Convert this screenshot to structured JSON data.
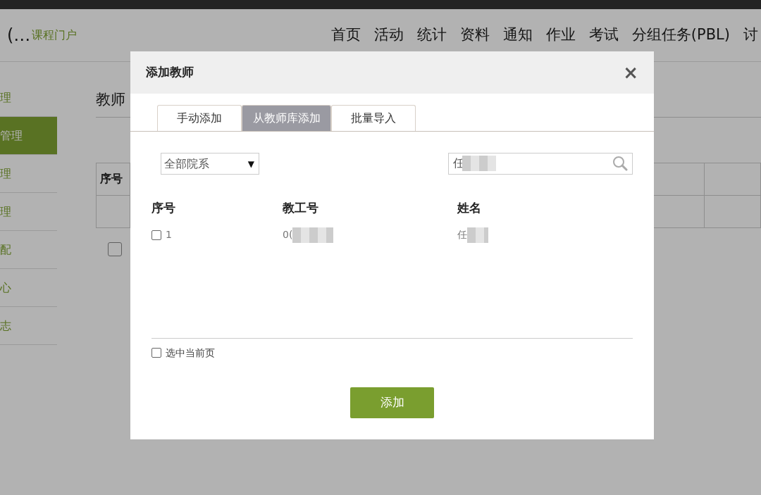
{
  "page": {
    "brand_prefix": "(…",
    "brand": "课程门户",
    "nav": [
      "首页",
      "活动",
      "统计",
      "资料",
      "通知",
      "作业",
      "考试",
      "分组任务(PBL)",
      "讨"
    ],
    "sidebar": [
      {
        "label": "理",
        "selected": false
      },
      {
        "label": "管理",
        "selected": true
      },
      {
        "label": "理",
        "selected": false
      },
      {
        "label": "理",
        "selected": false
      },
      {
        "label": "配",
        "selected": false
      },
      {
        "label": "心",
        "selected": false
      },
      {
        "label": "志",
        "selected": false
      }
    ],
    "heading": "教师",
    "table_header": "序号",
    "row_checked": false
  },
  "dialog": {
    "title": "添加教师",
    "close": "×",
    "tabs": [
      {
        "label": "手动添加",
        "selected": false
      },
      {
        "label": "从教师库添加",
        "selected": true
      },
      {
        "label": "批量导入",
        "selected": false
      }
    ],
    "department": "全部院系",
    "department_caret": "▼",
    "search": {
      "value": "任"
    },
    "columns": [
      "序号",
      "教工号",
      "姓名"
    ],
    "rows": [
      {
        "checked": false,
        "index": "1",
        "staff_no": "0(",
        "name": "任"
      }
    ],
    "select_page": {
      "label": "选中当前页",
      "checked": false
    },
    "submit": "添加"
  }
}
